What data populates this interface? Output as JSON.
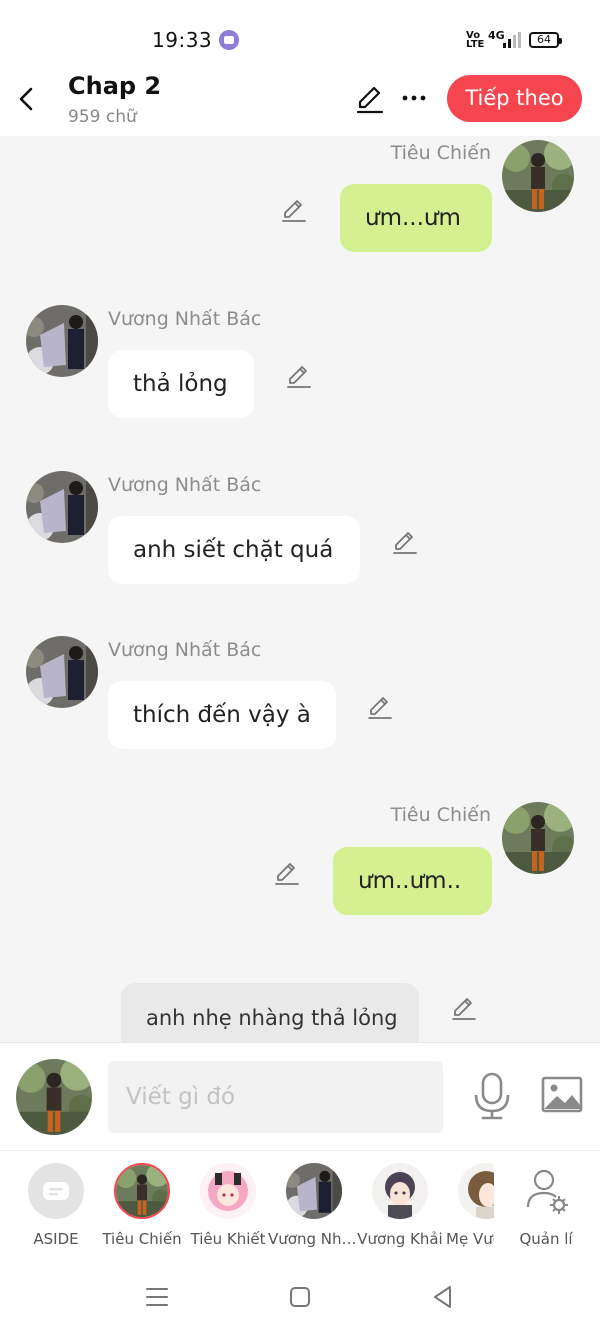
{
  "status_bar": {
    "time": "19:33",
    "network_label": "4G",
    "volte_label": "Vo\nLTE",
    "battery_level": "64"
  },
  "header": {
    "title": "Chap 2",
    "subtitle": "959 chữ",
    "next_label": "Tiếp theo"
  },
  "messages": [
    {
      "side": "right",
      "sender": "Tiêu Chiến",
      "text": "ưm...ưm"
    },
    {
      "side": "left",
      "sender": "Vương Nhất Bác",
      "text": "thả lỏng"
    },
    {
      "side": "left",
      "sender": "Vương Nhất Bác",
      "text": "anh siết chặt quá"
    },
    {
      "side": "left",
      "sender": "Vương Nhất Bác",
      "text": "thích đến vậy à"
    },
    {
      "side": "right",
      "sender": "Tiêu Chiến",
      "text": "ưm..ưm.."
    },
    {
      "side": "aside",
      "sender": "",
      "text": "anh nhẹ nhàng thả lỏng"
    }
  ],
  "composer": {
    "placeholder": "Viết gì đó"
  },
  "characters": [
    {
      "label": "ASIDE",
      "selected": false
    },
    {
      "label": "Tiêu Chiến",
      "selected": true
    },
    {
      "label": "Tiêu Khiết",
      "selected": false
    },
    {
      "label": "Vương Nhất Bác",
      "selected": false
    },
    {
      "label": "Vương Khải",
      "selected": false
    },
    {
      "label": "Mẹ Vương",
      "selected": false
    },
    {
      "label": "Quản lí",
      "selected": false
    }
  ],
  "colors": {
    "accent": "#f5464f",
    "bubble_right": "#d4f091",
    "bubble_left": "#ffffff",
    "bubble_aside": "#e9e9e9",
    "chat_bg": "#f5f5f5"
  }
}
